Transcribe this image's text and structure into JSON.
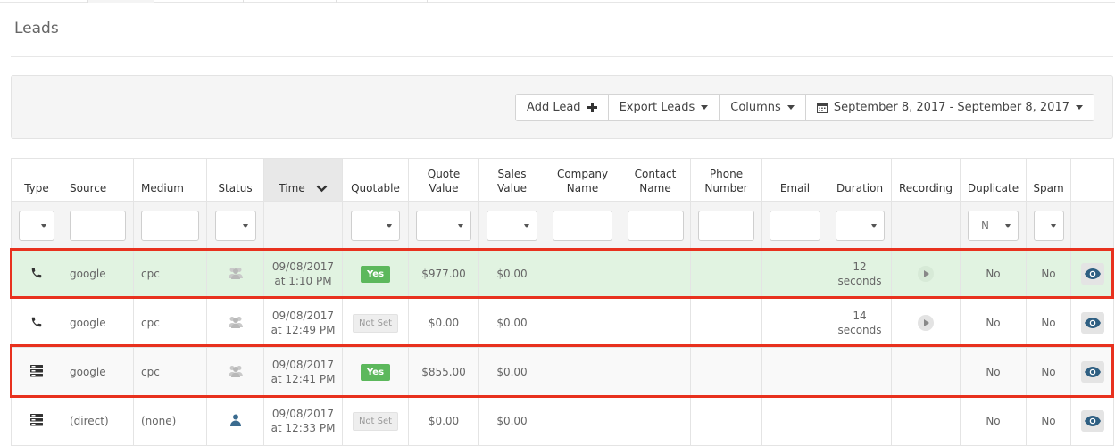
{
  "page": {
    "title": "Leads"
  },
  "toolbar": {
    "add_lead": "Add Lead",
    "export_leads": "Export Leads",
    "columns": "Columns",
    "date_range": "September 8, 2017 - September 8, 2017"
  },
  "columns": {
    "type": "Type",
    "source": "Source",
    "medium": "Medium",
    "status": "Status",
    "time": "Time",
    "quotable": "Quotable",
    "quote_value_1": "Quote",
    "quote_value_2": "Value",
    "sales_value_1": "Sales",
    "sales_value_2": "Value",
    "company_name_1": "Company",
    "company_name_2": "Name",
    "contact_name_1": "Contact",
    "contact_name_2": "Name",
    "phone_number_1": "Phone",
    "phone_number_2": "Number",
    "email": "Email",
    "duration": "Duration",
    "recording": "Recording",
    "duplicate": "Duplicate",
    "spam": "Spam"
  },
  "filters": {
    "duplicate_value": "N"
  },
  "rows": [
    {
      "type_icon": "phone-icon",
      "source": "google",
      "medium": "cpc",
      "status_icon": "group-icon",
      "time_date": "09/08/2017",
      "time_clock": "at 1:10 PM",
      "quotable": "Yes",
      "quote_value": "$977.00",
      "sales_value": "$0.00",
      "duration_1": "12",
      "duration_2": "seconds",
      "duplicate": "No",
      "spam": "No"
    },
    {
      "type_icon": "phone-icon",
      "source": "google",
      "medium": "cpc",
      "status_icon": "group-icon",
      "time_date": "09/08/2017",
      "time_clock": "at 12:49 PM",
      "quotable": "Not Set",
      "quote_value": "$0.00",
      "sales_value": "$0.00",
      "duration_1": "14",
      "duration_2": "seconds",
      "duplicate": "No",
      "spam": "No"
    },
    {
      "type_icon": "form-icon",
      "source": "google",
      "medium": "cpc",
      "status_icon": "group-icon",
      "time_date": "09/08/2017",
      "time_clock": "at 12:41 PM",
      "quotable": "Yes",
      "quote_value": "$855.00",
      "sales_value": "$0.00",
      "duration_1": "",
      "duration_2": "",
      "duplicate": "No",
      "spam": "No"
    },
    {
      "type_icon": "form-icon",
      "source": "(direct)",
      "medium": "(none)",
      "status_icon": "user-icon",
      "time_date": "09/08/2017",
      "time_clock": "at 12:33 PM",
      "quotable": "Not Set",
      "quote_value": "$0.00",
      "sales_value": "$0.00",
      "duration_1": "",
      "duration_2": "",
      "duplicate": "No",
      "spam": "No"
    }
  ],
  "colors": {
    "highlight_row": "#e1f3e1",
    "annotation_box": "#e8311e",
    "badge_yes": "#5cb85c",
    "money": "#2e6f8e"
  }
}
